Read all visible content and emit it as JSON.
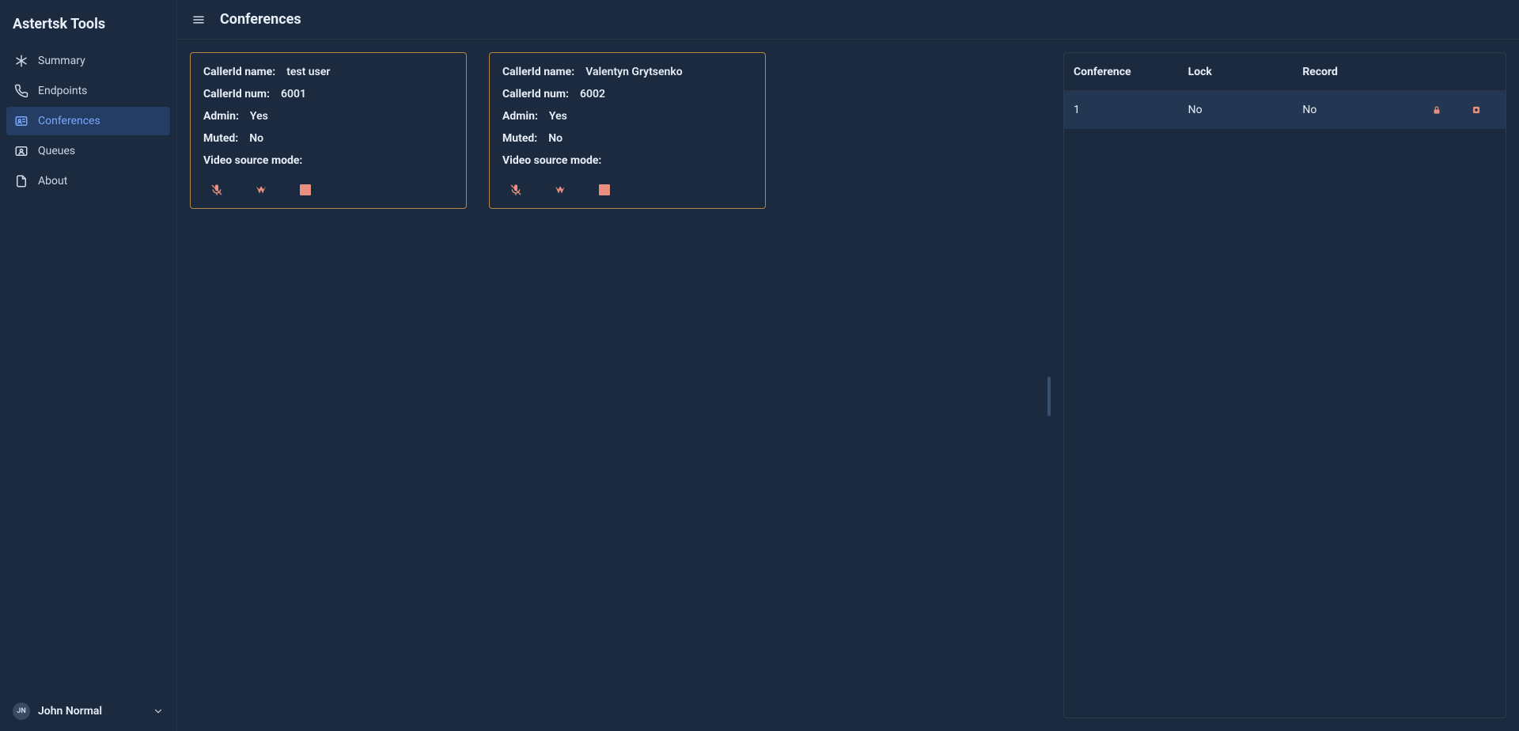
{
  "brand": "Astertsk Tools",
  "nav": {
    "summary": "Summary",
    "endpoints": "Endpoints",
    "conferences": "Conferences",
    "queues": "Queues",
    "about": "About"
  },
  "user": {
    "initials": "JN",
    "name": "John Normal"
  },
  "header": {
    "title": "Conferences"
  },
  "labels": {
    "callerIdName": "CallerId name:",
    "callerIdNum": "CallerId num:",
    "admin": "Admin:",
    "muted": "Muted:",
    "videoSourceMode": "Video source mode:"
  },
  "participants": [
    {
      "name": "test user",
      "num": "6001",
      "admin": "Yes",
      "muted": "No",
      "videoSourceMode": ""
    },
    {
      "name": "Valentyn Grytsenko",
      "num": "6002",
      "admin": "Yes",
      "muted": "No",
      "videoSourceMode": ""
    }
  ],
  "table": {
    "columns": {
      "conference": "Conference",
      "lock": "Lock",
      "record": "Record"
    },
    "rows": [
      {
        "conference": "1",
        "lock": "No",
        "record": "No"
      }
    ]
  }
}
